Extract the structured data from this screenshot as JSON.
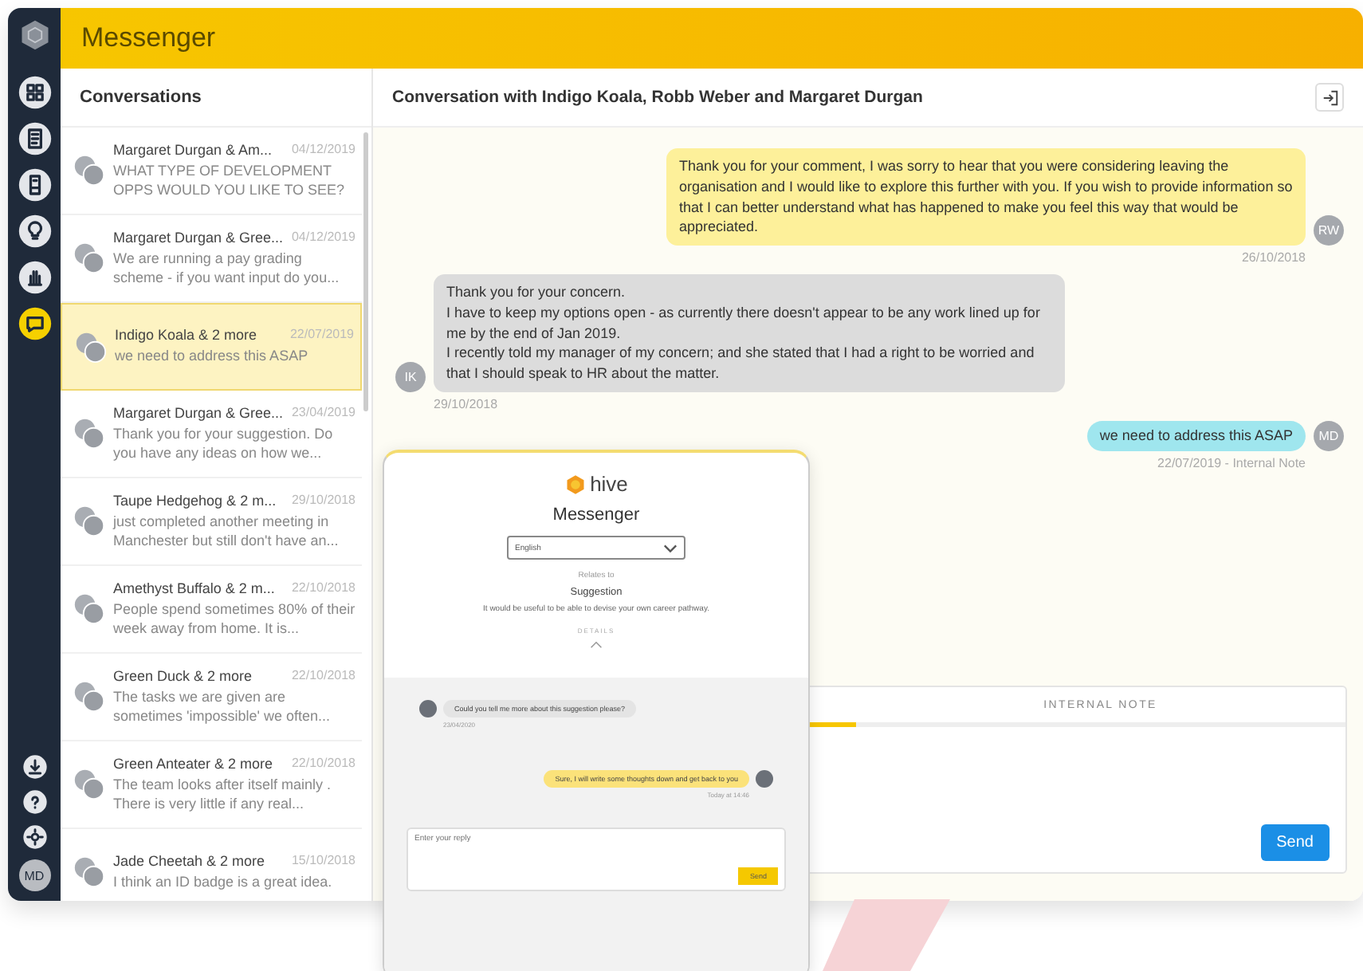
{
  "app": {
    "title": "Messenger"
  },
  "sidebar": {
    "items": [
      {
        "selected": false
      },
      {
        "selected": false
      },
      {
        "selected": false
      },
      {
        "selected": false
      },
      {
        "selected": false
      },
      {
        "selected": true
      }
    ],
    "user": "MD"
  },
  "conversations": {
    "title": "Conversations",
    "items": [
      {
        "name": "Margaret Durgan & Am...",
        "date": "04/12/2019",
        "preview": "WHAT TYPE OF DEVELOPMENT OPPS WOULD YOU LIKE TO SEE?",
        "selected": false
      },
      {
        "name": "Margaret Durgan & Gree...",
        "date": "04/12/2019",
        "preview": "We are running a pay grading scheme - if you want input do you...",
        "selected": false
      },
      {
        "name": "Indigo Koala & 2 more",
        "date": "22/07/2019",
        "preview": "we need to address this ASAP",
        "selected": true
      },
      {
        "name": "Margaret Durgan & Gree...",
        "date": "23/04/2019",
        "preview": "Thank you for your suggestion. Do you have any ideas on how we...",
        "selected": false
      },
      {
        "name": "Taupe Hedgehog & 2 m...",
        "date": "29/10/2018",
        "preview": "just completed another meeting in Manchester but still don't have an...",
        "selected": false
      },
      {
        "name": "Amethyst Buffalo & 2 m...",
        "date": "22/10/2018",
        "preview": "People spend sometimes 80% of their week away from home. It is...",
        "selected": false
      },
      {
        "name": "Green Duck & 2 more",
        "date": "22/10/2018",
        "preview": "The tasks we are given are sometimes 'impossible' we often...",
        "selected": false
      },
      {
        "name": "Green Anteater & 2 more",
        "date": "22/10/2018",
        "preview": "The team looks after itself mainly . There is very little if any real...",
        "selected": false
      },
      {
        "name": "Jade Cheetah & 2 more",
        "date": "15/10/2018",
        "preview": "I think an ID badge is a great idea.",
        "selected": false
      }
    ]
  },
  "conversation": {
    "title": "Conversation with Indigo Koala, Robb Weber and Margaret Durgan",
    "messages": [
      {
        "kind": "outgoing",
        "text": "Thank you for your comment, I was sorry to hear that you were considering leaving the organisation and I would like to explore this further with you.  If you wish to provide information so that I can better understand what has happened to make you feel this way that would be appreciated.",
        "avatar": "RW",
        "meta": "26/10/2018"
      },
      {
        "kind": "incoming",
        "text": "Thank you for your concern.\nI have to keep my options open - as currently there doesn't appear to be any work lined up for me by the end of Jan 2019.\nI recently told my manager of my concern; and she stated that I had a right to be worried and that I should speak to HR about the matter.",
        "avatar": "IK",
        "meta": "29/10/2018"
      },
      {
        "kind": "note",
        "text": "we need to address this ASAP",
        "avatar": "MD",
        "meta": "22/07/2019 - Internal Note"
      }
    ],
    "composer": {
      "tabs": [
        {
          "label": "INTERNAL NOTE",
          "selected": false
        }
      ],
      "send": "Send"
    }
  },
  "widget": {
    "brand": "hive",
    "title": "Messenger",
    "language": "English",
    "relates_label": "Relates to",
    "relates_value": "Suggestion",
    "description": "It would be useful to be able to devise your own career pathway.",
    "details": "DETAILS",
    "messages": [
      {
        "kind": "incoming",
        "text": "Could you tell me more about this suggestion please?",
        "meta": "23/04/2020"
      },
      {
        "kind": "outgoing",
        "text": "Sure, I will write some thoughts down and get back to you",
        "meta": "Today at 14:46"
      }
    ],
    "reply": {
      "placeholder": "Enter your reply"
    },
    "send": "Send"
  }
}
